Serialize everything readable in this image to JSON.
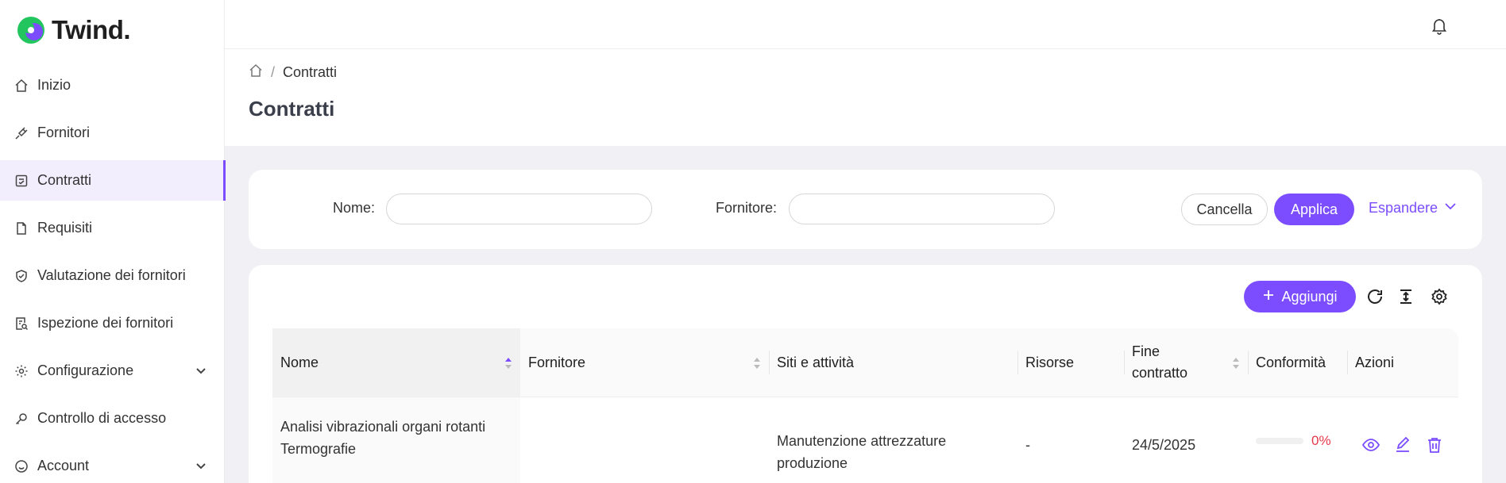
{
  "brand": {
    "name": "Twind.",
    "accent": "#7b4dff",
    "logo_green": "#22c55e"
  },
  "sidebar": {
    "items": [
      {
        "label": "Inizio",
        "icon": "home-icon"
      },
      {
        "label": "Fornitori",
        "icon": "plug-icon"
      },
      {
        "label": "Contratti",
        "icon": "contract-icon",
        "active": true
      },
      {
        "label": "Requisiti",
        "icon": "document-icon"
      },
      {
        "label": "Valutazione dei fornitori",
        "icon": "shield-check-icon"
      },
      {
        "label": "Ispezione dei fornitori",
        "icon": "inspection-icon"
      },
      {
        "label": "Configurazione",
        "icon": "gear-icon",
        "expandable": true
      },
      {
        "label": "Controllo di accesso",
        "icon": "key-icon"
      },
      {
        "label": "Account",
        "icon": "smile-icon",
        "expandable": true
      }
    ]
  },
  "breadcrumb": {
    "current": "Contratti"
  },
  "page": {
    "title": "Contratti"
  },
  "filters": {
    "name_label": "Nome",
    "name_value": "",
    "supplier_label": "Fornitore",
    "supplier_value": "",
    "cancel_label": "Cancella",
    "apply_label": "Applica",
    "expand_label": "Espandere"
  },
  "toolbar": {
    "add_label": "Aggiungi"
  },
  "table": {
    "columns": [
      "Nome",
      "Fornitore",
      "Siti e attività",
      "Risorse",
      "Fine contratto",
      "Conformità",
      "Azioni"
    ],
    "rows": [
      {
        "name": "Analisi vibrazionali organi rotanti Termografie",
        "supplier": "",
        "sites": "Manutenzione attrezzature produzione",
        "resources": "-",
        "end_date": "24/5/2025",
        "compliance": 0,
        "compliance_label": "0%"
      }
    ]
  }
}
